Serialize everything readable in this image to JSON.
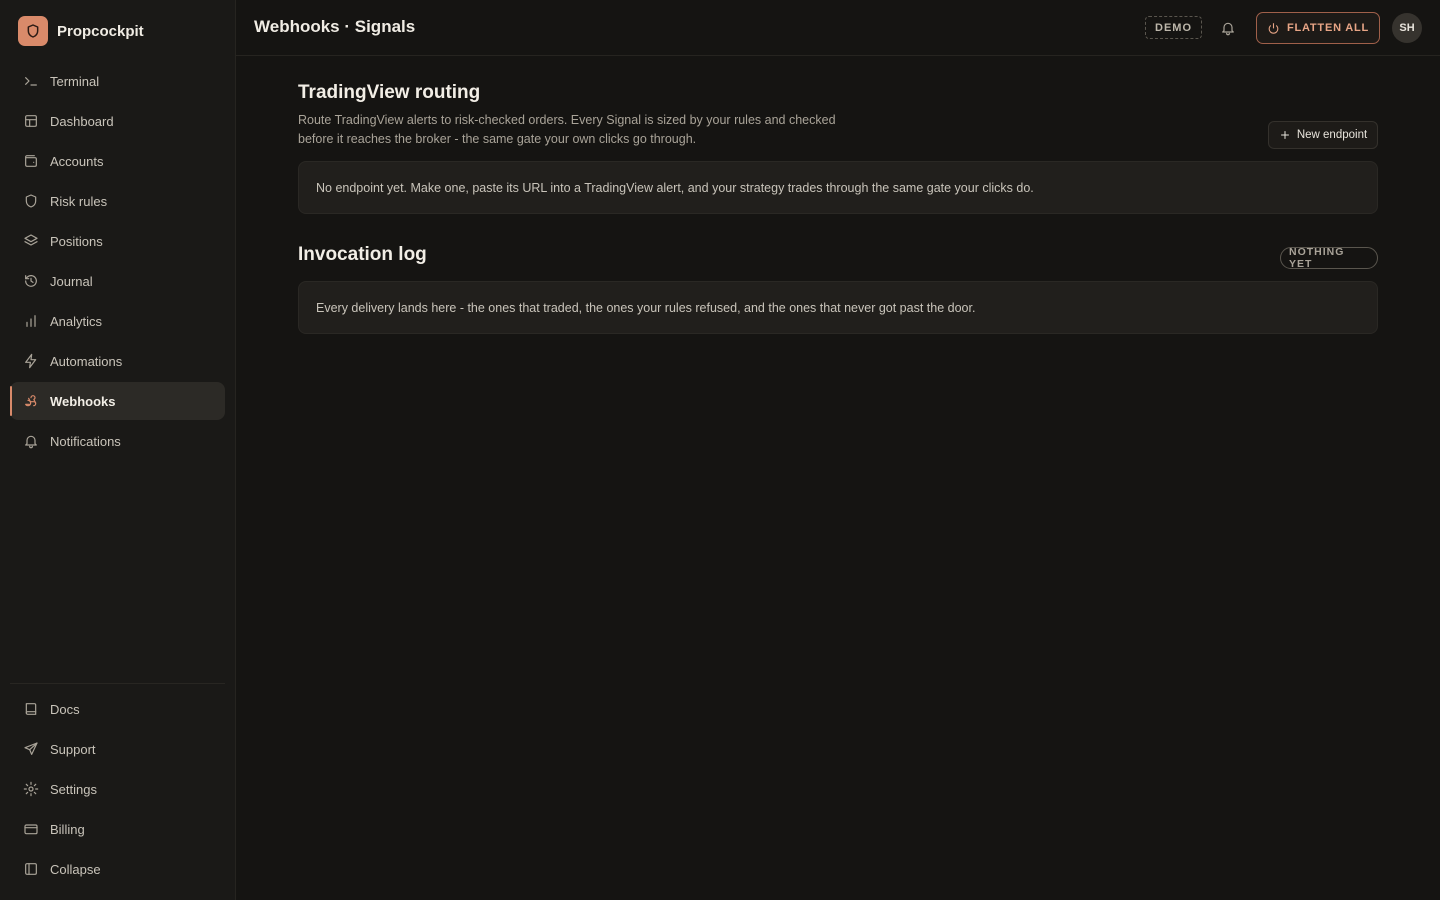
{
  "brand": {
    "name": "Propcockpit",
    "accent": "#d98a6a"
  },
  "sidebar": {
    "items": [
      {
        "label": "Terminal",
        "icon": "terminal-icon"
      },
      {
        "label": "Dashboard",
        "icon": "layout-icon"
      },
      {
        "label": "Accounts",
        "icon": "wallet-icon"
      },
      {
        "label": "Risk rules",
        "icon": "shield-icon"
      },
      {
        "label": "Positions",
        "icon": "layers-icon"
      },
      {
        "label": "Journal",
        "icon": "history-icon"
      },
      {
        "label": "Analytics",
        "icon": "bar-chart-icon"
      },
      {
        "label": "Automations",
        "icon": "lightning-icon"
      },
      {
        "label": "Webhooks",
        "icon": "webhook-icon",
        "active": true
      },
      {
        "label": "Notifications",
        "icon": "bell-icon"
      }
    ],
    "bottom": [
      {
        "label": "Docs",
        "icon": "book-icon"
      },
      {
        "label": "Support",
        "icon": "send-icon"
      },
      {
        "label": "Settings",
        "icon": "gear-icon"
      },
      {
        "label": "Billing",
        "icon": "credit-card-icon"
      },
      {
        "label": "Collapse",
        "icon": "sidebar-collapse-icon"
      }
    ]
  },
  "header": {
    "title": "Webhooks · Signals",
    "demo_badge": "DEMO",
    "flatten_label": "FLATTEN ALL",
    "avatar_initials": "SH"
  },
  "routing": {
    "title": "TradingView routing",
    "description": "Route TradingView alerts to risk-checked orders. Every Signal is sized by your rules and checked before it reaches the broker - the same gate your own clicks go through.",
    "new_endpoint_label": "New endpoint",
    "empty_text": "No endpoint yet. Make one, paste its URL into a TradingView alert, and your strategy trades through the same gate your clicks do."
  },
  "log": {
    "title": "Invocation log",
    "status_badge": "NOTHING YET",
    "empty_text": "Every delivery lands here - the ones that traded, the ones your rules refused, and the ones that never got past the door."
  }
}
